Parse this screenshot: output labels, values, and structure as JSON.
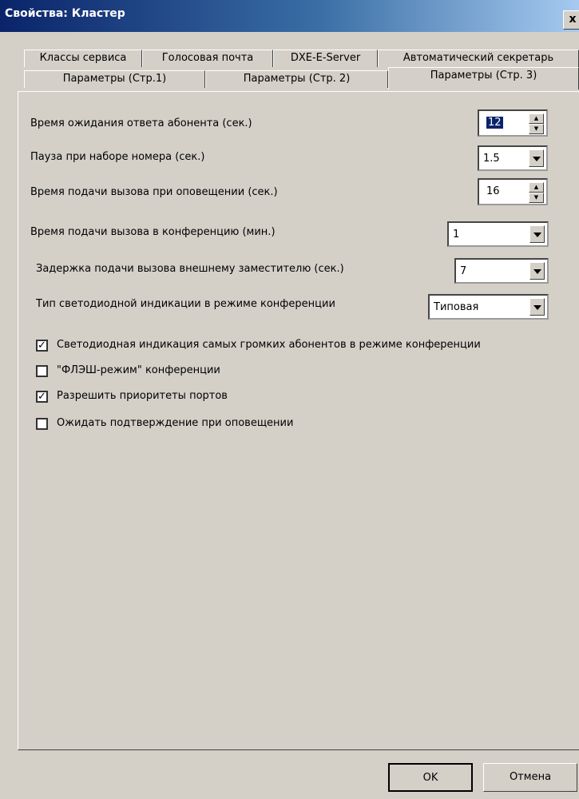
{
  "window": {
    "title": "Свойства: Кластер",
    "close_glyph": "x"
  },
  "tabs_row1": [
    "Классы сервиса",
    "Голосовая почта",
    "DXE-E-Server",
    "Автоматический секретарь"
  ],
  "tabs_row2": [
    "Параметры (Стр.1)",
    "Параметры (Стр. 2)",
    "Параметры (Стр. 3)"
  ],
  "active_tab": "Параметры (Стр. 3)",
  "settings": {
    "answer_wait": {
      "label": "Время ожидания ответа абонента (сек.)",
      "value": "12"
    },
    "dial_pause": {
      "label": "Пауза при наборе номера (сек.)",
      "value": "1.5"
    },
    "notify_call_time": {
      "label": "Время подачи вызова при оповещении (сек.)",
      "value": "16"
    },
    "conf_call_time": {
      "label": "Время подачи вызова в конференцию (мин.)",
      "value": "1"
    },
    "ext_deputy_delay": {
      "label": "Задержка подачи вызова внешнему заместителю (сек.)",
      "value": "7"
    },
    "led_type": {
      "label": "Тип светодиодной индикации в режиме конференции",
      "value": "Типовая"
    }
  },
  "checkboxes": [
    {
      "label": "Светодиодная индикация самых громких абонентов в режиме конференции",
      "checked": true
    },
    {
      "label": "\"ФЛЭШ-режим\" конференции",
      "checked": false
    },
    {
      "label": "Разрешить приоритеты портов",
      "checked": true
    },
    {
      "label": "Ожидать подтверждение при оповещении",
      "checked": false
    }
  ],
  "buttons": {
    "ok": "OK",
    "cancel": "Отмена"
  }
}
